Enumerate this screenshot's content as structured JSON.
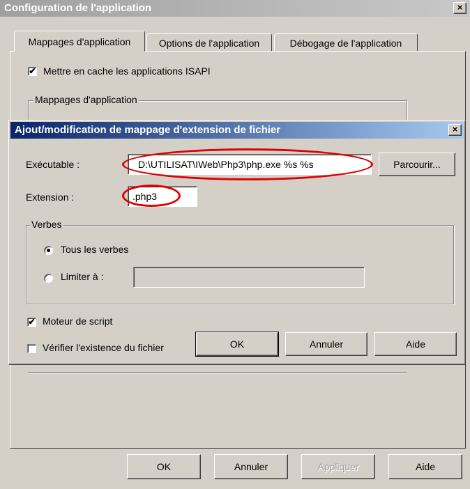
{
  "outer_window": {
    "title": "Configuration de l'application",
    "close_label": "×",
    "tabs": [
      {
        "label": "Mappages d'application"
      },
      {
        "label": "Options de l'application"
      },
      {
        "label": "Débogage de l'application"
      }
    ],
    "cache_isapi_label": "Mettre en cache les applications ISAPI",
    "cache_isapi_checked": "✔",
    "mappings_group_label": "Mappages d'application",
    "buttons": {
      "ok": "OK",
      "cancel": "Annuler",
      "apply": "Appliquer",
      "help": "Aide"
    }
  },
  "dialog": {
    "title": "Ajout/modification de mappage d'extension de fichier",
    "close_label": "×",
    "executable_label": "Exécutable :",
    "executable_value": "D:\\UTILISAT\\IWeb\\Php3\\php.exe %s %s",
    "browse_button": "Parcourir...",
    "extension_label": "Extension :",
    "extension_value": ".php3",
    "verbs_group_label": "Verbes",
    "all_verbs_label": "Tous les verbes",
    "limit_to_label": "Limiter à :",
    "limit_to_value": "",
    "script_engine_label": "Moteur de script",
    "script_engine_checked": "✔",
    "check_file_exists_label": "Vérifier l'existence du fichier",
    "buttons": {
      "ok": "OK",
      "cancel": "Annuler",
      "help": "Aide"
    }
  },
  "colors": {
    "annotation_ring": "#e00000",
    "active_title": "#0a246a",
    "inactive_title": "#a0a0a0"
  }
}
